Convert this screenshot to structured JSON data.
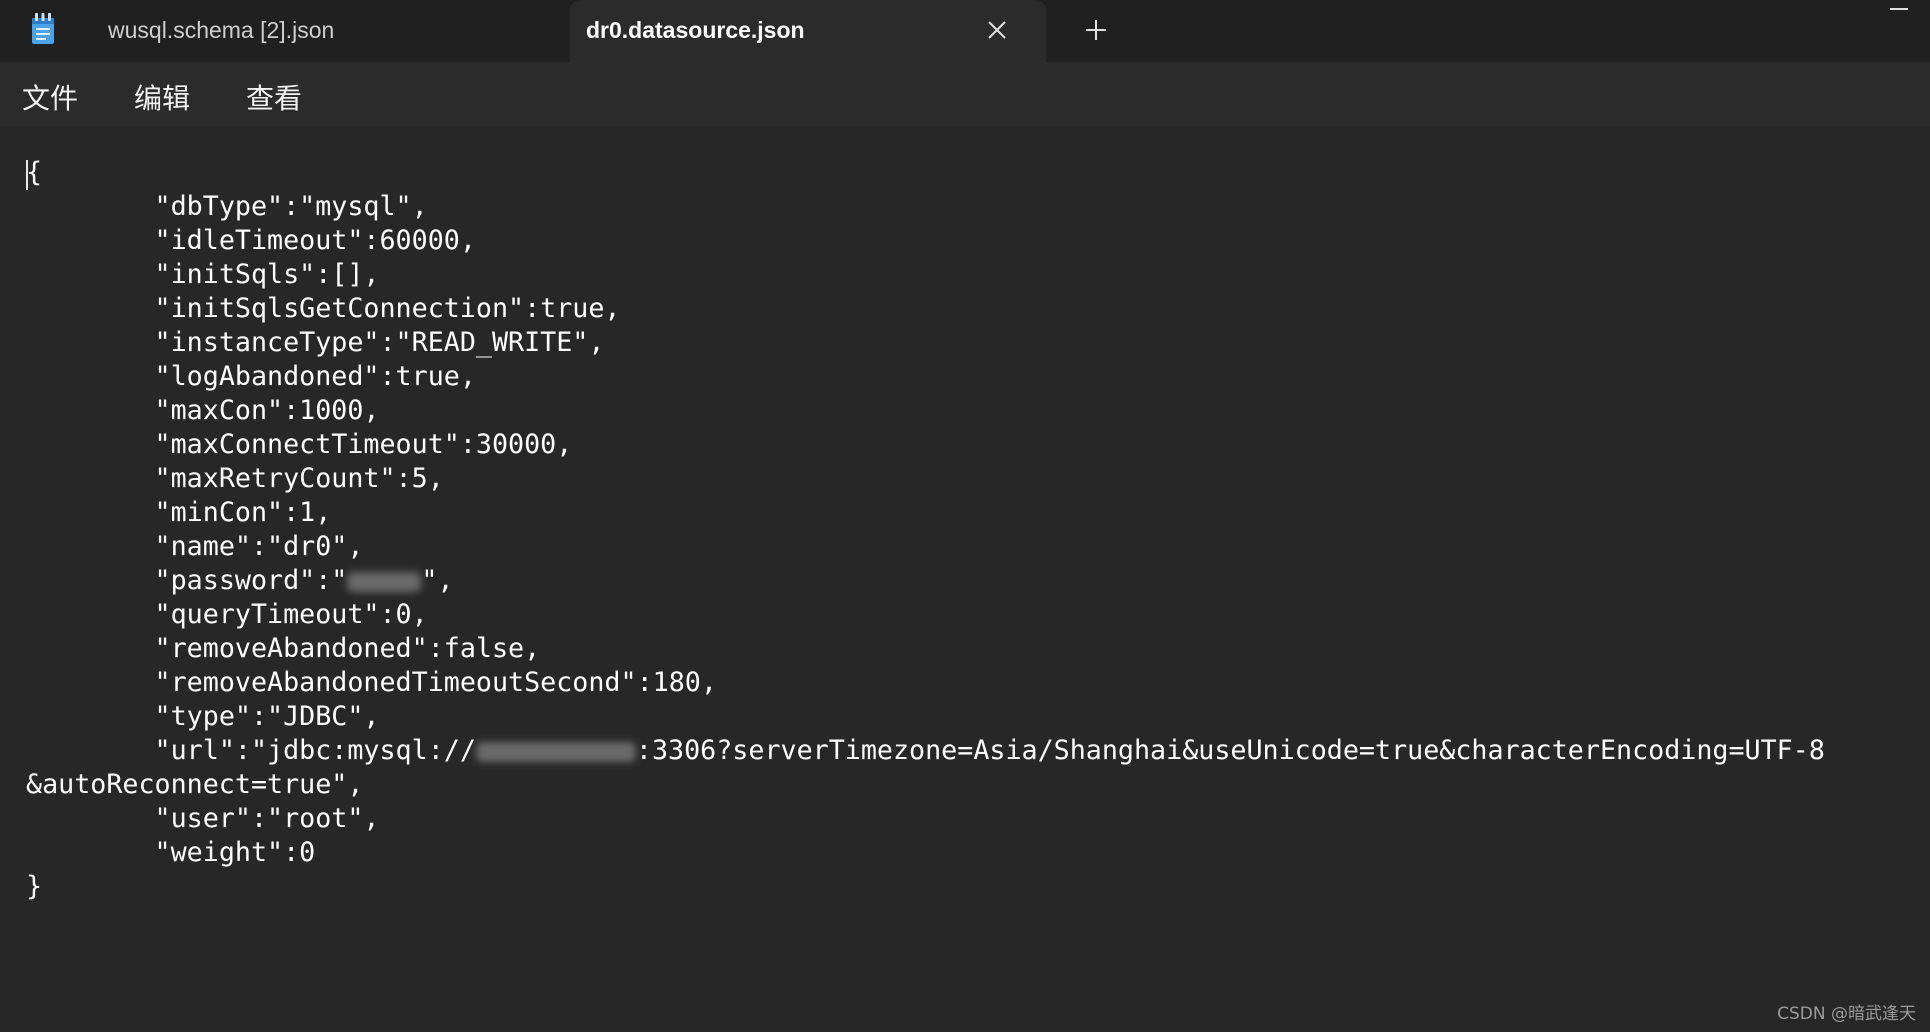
{
  "tabs": [
    {
      "label": "wusql.schema [2].json",
      "icon": "notepad-icon",
      "active": false
    },
    {
      "label": "dr0.datasource.json",
      "active": true
    }
  ],
  "menu": {
    "file": "文件",
    "edit": "编辑",
    "view": "查看"
  },
  "editor": {
    "lines": [
      "{",
      "\t\"dbType\":\"mysql\",",
      "\t\"idleTimeout\":60000,",
      "\t\"initSqls\":[],",
      "\t\"initSqlsGetConnection\":true,",
      "\t\"instanceType\":\"READ_WRITE\",",
      "\t\"logAbandoned\":true,",
      "\t\"maxCon\":1000,",
      "\t\"maxConnectTimeout\":30000,",
      "\t\"maxRetryCount\":5,",
      "\t\"minCon\":1,",
      "\t\"name\":\"dr0\",",
      "\t\"password\":\"",
      "\",",
      "\t\"queryTimeout\":0,",
      "\t\"removeAbandoned\":false,",
      "\t\"removeAbandonedTimeoutSecond\":180,",
      "\t\"type\":\"JDBC\",",
      "\t\"url\":\"jdbc:mysql://",
      ":3306?serverTimezone=Asia/Shanghai&useUnicode=true&characterEncoding=UTF-8",
      "&autoReconnect=true\",",
      "\t\"user\":\"root\",",
      "\t\"weight\":0",
      "}"
    ]
  },
  "watermark": "CSDN @暗武逢天",
  "colors": {
    "background": "#272727",
    "tabbar": "#202020",
    "active_tab": "#2b2b2b",
    "text": "#ffffff"
  }
}
